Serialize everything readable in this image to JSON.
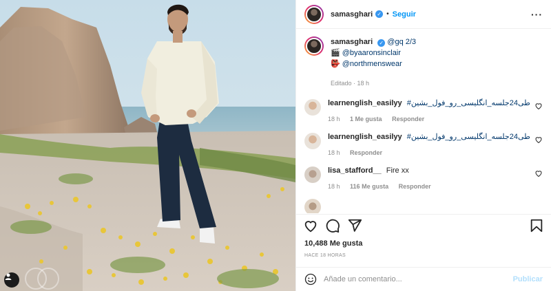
{
  "post": {
    "username": "samasghari",
    "follow_label": "Seguir",
    "separator": "•",
    "more_label": "···"
  },
  "caption": {
    "username": "samasghari",
    "text": "@gq 2/3",
    "line2_icon": "🎬",
    "line2_text": "@byaaronsinclair",
    "line3_icon": "👺",
    "line3_text": "@northmenswear",
    "meta": "Editado · 18 h"
  },
  "comments": [
    {
      "username": "learnenglish_easilyy",
      "text": "#طی24جلسه_انگلیسی_رو_فول_بشین",
      "time": "18 h",
      "likes": "1 Me gusta",
      "reply": "Responder"
    },
    {
      "username": "learnenglish_easilyy",
      "text": "#طی24جلسه_انگلیسی_رو_فول_بشین",
      "time": "18 h",
      "likes": "",
      "reply": "Responder"
    },
    {
      "username": "lisa_stafford__",
      "text": "Fire xx",
      "time": "18 h",
      "likes": "116 Me gusta",
      "reply": "Responder"
    }
  ],
  "stats": {
    "likes": "10,488 Me gusta",
    "time_ago": "HACE 18 HORAS"
  },
  "add_comment": {
    "placeholder": "Añade un comentario...",
    "publish_label": "Publicar"
  },
  "icons": [
    "user-tag-icon",
    "verified-icon",
    "more-icon",
    "heart-icon",
    "comment-icon",
    "share-icon",
    "bookmark-icon",
    "emoji-icon"
  ],
  "colors": {
    "accent": "#0095f6",
    "publish_disabled": "#b2dffc",
    "muted": "#8e8e8e"
  }
}
